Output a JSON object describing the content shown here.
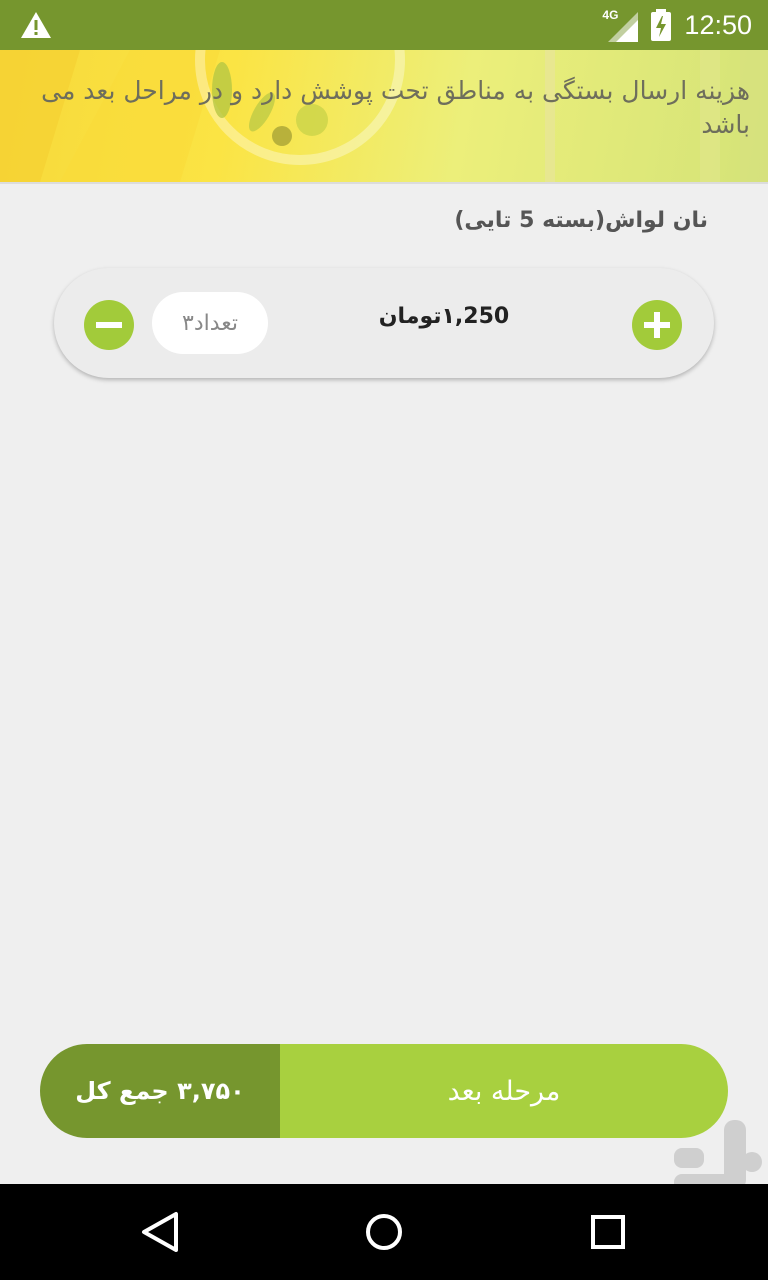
{
  "status_bar": {
    "network": "4G",
    "time": "12:50",
    "warning_icon": "warning-triangle-icon",
    "battery_icon": "battery-charging-icon"
  },
  "banner": {
    "text": "هزینه ارسال بستگی به مناطق تحت پوشش دارد و در مراحل بعد می باشد"
  },
  "product": {
    "title": "نان لواش(بسته 5 تایی)",
    "price": "۱,250تومان",
    "quantity_label": "تعداد۳"
  },
  "footer": {
    "total": "۳,۷۵۰ جمع کل",
    "next_label": "مرحله بعد"
  },
  "colors": {
    "primary_dark": "#76962e",
    "primary_light": "#a8d03f",
    "background": "#efefef"
  }
}
